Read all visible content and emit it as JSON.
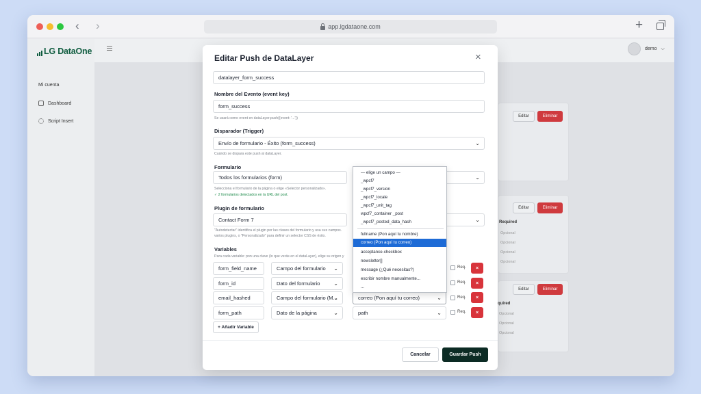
{
  "browser": {
    "url": "app.lgdataone.com"
  },
  "app": {
    "logo": "LG DataOne",
    "sidebar": {
      "section_label": "Mi cuenta",
      "items": [
        {
          "label": "Dashboard",
          "icon": "dashboard-icon"
        },
        {
          "label": "Script Insert",
          "icon": "gear-icon"
        }
      ]
    },
    "user": {
      "name": "demo"
    }
  },
  "background_cards": {
    "edit_label": "Editar",
    "delete_label": "Eliminar",
    "required_label": "Required",
    "required_short": "quired",
    "optional_label": "Opcional"
  },
  "modal": {
    "title": "Editar Push de DataLayer",
    "name_value": "datalayer_form_success",
    "event_label": "Nombre del Evento (event key)",
    "event_value": "form_success",
    "event_hint": "Se usará como event en dataLayer.push({event: '...'})",
    "trigger_label": "Disparador (Trigger)",
    "trigger_value": "Envío de formulario - Éxito (form_success)",
    "trigger_hint": "Cuándo se dispara este push al dataLayer.",
    "form_label": "Formulario",
    "form_value": "Todos los formularios (form)",
    "form_hint": "Selecciona el formulario de la página o elige «Selector personalizado».",
    "form_detected": "✓ 2 formularios detectados en la URL del post.",
    "plugin_label": "Plugin de formulario",
    "plugin_value": "Contact Form 7",
    "plugin_hint_1": "\"Autodetectar\" identifica el plugin por las clases del formulario y usa sus campos.",
    "plugin_hint_2": "varios plugins, o \"Personalizado\" para definir un selector CSS de éxito.",
    "variables_label": "Variables",
    "variables_hint": "Para cada variable: pon una clave (lo que verás en el dataLayer), elige su origen y",
    "req_label": "Req.",
    "remove_label": "×",
    "variables": [
      {
        "key": "form_field_name",
        "source": "Campo del formulario",
        "value": ""
      },
      {
        "key": "form_id",
        "source": "Dato del formulario",
        "value": ""
      },
      {
        "key": "email_hashed",
        "source": "Campo del formulario (M...",
        "value": "correo (Pon aquí tu correo)"
      },
      {
        "key": "form_path",
        "source": "Dato de la página",
        "value": "path"
      }
    ],
    "add_variable": "+ Añadir Variable",
    "cancel": "Cancelar",
    "save": "Guardar Push"
  },
  "dropdown": {
    "options": [
      "— elige un campo —",
      "_wpcf7",
      "_wpcf7_version",
      "_wpcf7_locale",
      "_wpcf7_unit_tag",
      "wpcf7_container _post",
      "_wpcf7_posted_data_hash",
      "fullname (Pon aquí tu nombre)",
      "correo (Pon aquí tu correo)",
      "acceptance-checkbox",
      "newsletter[]",
      "message (¿Qué necesitas?)",
      "escribir nombre manualmente...",
      "..."
    ],
    "selected_index": 8
  },
  "colors": {
    "primary": "#0c2b24",
    "danger": "#d8343b",
    "brand": "#0f5c3f",
    "selection": "#1e6bd6"
  }
}
